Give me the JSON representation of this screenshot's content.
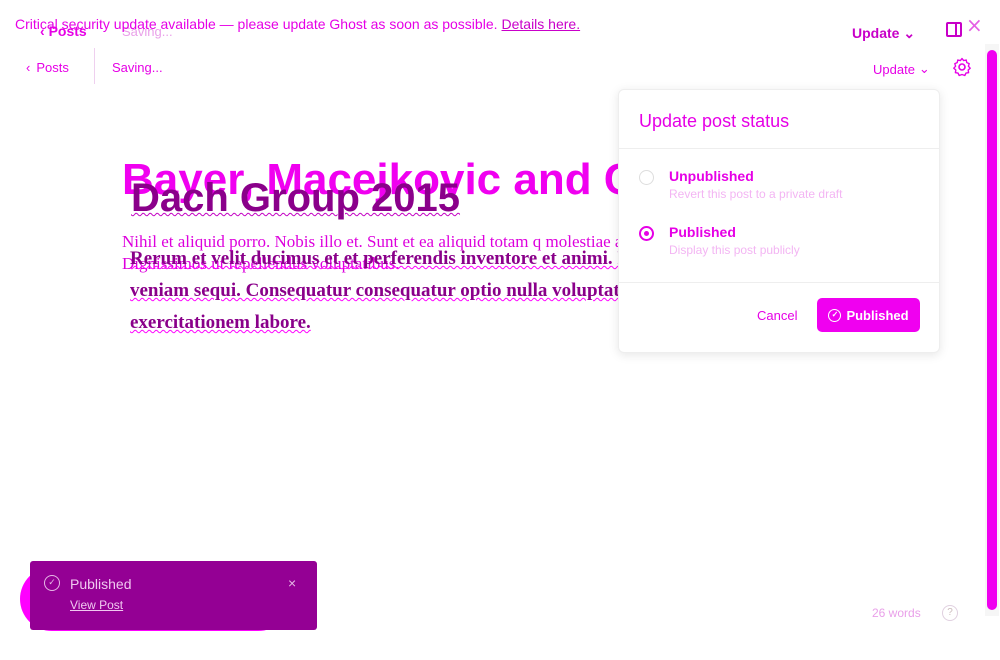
{
  "ghost_header": {
    "back_label": "Posts",
    "saving_label": "Saving...",
    "update_label": "Update",
    "close_glyph": "×"
  },
  "banner": {
    "text": "Critical security update available — please update Ghost as soon as possible.",
    "link": "Details here."
  },
  "editor_header": {
    "back_label": "Posts",
    "saving_label": "Saving...",
    "update_label": "Update"
  },
  "post": {
    "title_back": "Bayer, Macejkovic and C",
    "title_front": "Dach Group 2015",
    "paragraph_back": "Nihil et aliquid porro. Nobis illo et. Sunt et ea aliquid totam q molestiae aut. Dignissimos ut repellendus voluptatibus.",
    "paragraph_front": "Rerum et velit ducimus et et perferendis inventore et animi. Fugit consequuntur a mollitia veniam sequi. Consequatur consequatur optio nulla voluptatem voluptas rerum quidem exercitationem labore."
  },
  "popover": {
    "title": "Update post status",
    "options": [
      {
        "label": "Unpublished",
        "description": "Revert this post to a private draft",
        "selected": false
      },
      {
        "label": "Published",
        "description": "Display this post publicly",
        "selected": true
      }
    ],
    "cancel_label": "Cancel",
    "confirm_label": "Published"
  },
  "footer": {
    "word_count": "26 words",
    "help_glyph": "?"
  },
  "toast": {
    "title": "Published",
    "link": "View Post",
    "close_glyph": "×"
  },
  "colors": {
    "accent": "#f000f0",
    "dark_accent": "#8a008a",
    "toast_bg": "#940094"
  }
}
